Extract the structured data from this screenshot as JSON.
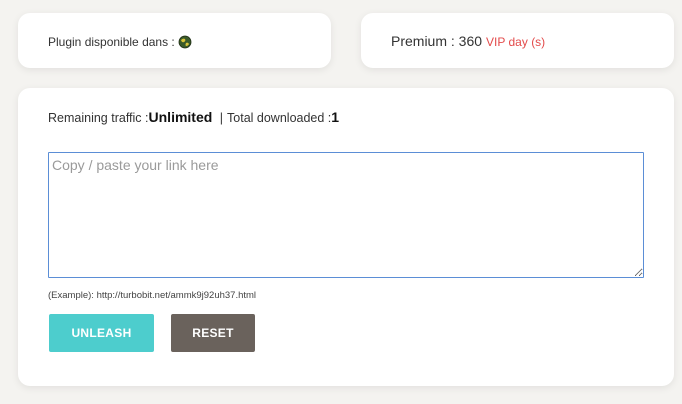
{
  "plugin": {
    "label": "Plugin disponible dans :",
    "icon": "globe-icon"
  },
  "premium": {
    "label": "Premium : 360",
    "vip_text": "VIP day (s)",
    "vip_color": "#e34b4b"
  },
  "traffic": {
    "remaining_label": "Remaining traffic :",
    "remaining_value": "Unlimited",
    "separator": "|",
    "downloaded_label": "Total downloaded :",
    "downloaded_value": "1"
  },
  "link_input": {
    "placeholder": "Copy / paste your link here",
    "value": ""
  },
  "example": "(Example): http://turbobit.net/ammk9j92uh37.html",
  "buttons": {
    "unleash": "UNLEASH",
    "reset": "RESET",
    "unleash_color": "#4dcdcd",
    "reset_color": "#6a625c"
  }
}
